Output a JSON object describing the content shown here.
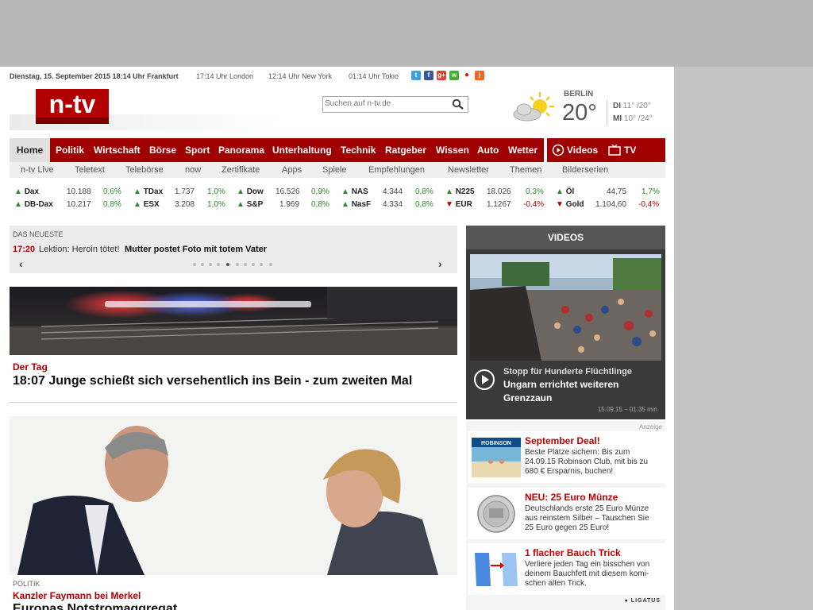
{
  "topbar": {
    "date": "Dienstag, 15. September 2015 18:14 Uhr Frankfurt",
    "london": "17:14 Uhr London",
    "newyork": "12:14 Uhr New York",
    "tokio": "01:14 Uhr Tokio",
    "social_icons": [
      "twitter-icon",
      "facebook-icon",
      "google-plus-icon",
      "whatsapp-icon",
      "pinterest-icon",
      "rss-icon"
    ]
  },
  "logo": {
    "text": "n-tv"
  },
  "search": {
    "placeholder": "Suchen auf n-tv.de"
  },
  "weather": {
    "city": "BERLIN",
    "temp": "20°",
    "forecast": [
      {
        "day": "DI",
        "range": "11° /20°"
      },
      {
        "day": "MI",
        "range": "10° /24°"
      }
    ]
  },
  "nav": {
    "items": [
      "Home",
      "Politik",
      "Wirtschaft",
      "Börse",
      "Sport",
      "Panorama",
      "Unterhaltung",
      "Technik",
      "Ratgeber",
      "Wissen",
      "Auto",
      "Wetter"
    ],
    "videos": "Videos",
    "tv": "TV",
    "active_color": "#9f0000"
  },
  "subnav": [
    "n-tv Live",
    "Teletext",
    "Telebörse",
    "now",
    "Zertifikate",
    "Apps",
    "Spiele",
    "Empfehlungen",
    "Newsletter",
    "Themen",
    "Bilderserien"
  ],
  "ticker": [
    {
      "name": "Dax",
      "value": "10.188",
      "change": "0,6%",
      "dir": "up"
    },
    {
      "name": "DB-Dax",
      "value": "10.217",
      "change": "0,8%",
      "dir": "up"
    },
    {
      "name": "TDax",
      "value": "1.737",
      "change": "1,0%",
      "dir": "up"
    },
    {
      "name": "ESX",
      "value": "3.208",
      "change": "1,0%",
      "dir": "up"
    },
    {
      "name": "Dow",
      "value": "16.526",
      "change": "0,9%",
      "dir": "up"
    },
    {
      "name": "S&P",
      "value": "1.969",
      "change": "0,8%",
      "dir": "up"
    },
    {
      "name": "NAS",
      "value": "4.344",
      "change": "0,8%",
      "dir": "up"
    },
    {
      "name": "NasF",
      "value": "4.334",
      "change": "0,8%",
      "dir": "up"
    },
    {
      "name": "N225",
      "value": "18.026",
      "change": "0,3%",
      "dir": "up"
    },
    {
      "name": "EUR",
      "value": "1,1267",
      "change": "-0,4%",
      "dir": "down"
    },
    {
      "name": "Öl",
      "value": "44,75",
      "change": "1,7%",
      "dir": "up"
    },
    {
      "name": "Gold",
      "value": "1.104,60",
      "change": "-0,4%",
      "dir": "down"
    }
  ],
  "newest": {
    "label": "DAS NEUESTE",
    "time": "17:20",
    "kicker": "Lektion: Heroin tötet!",
    "headline": "Mutter postet Foto mit totem Vater",
    "active_slide": 5,
    "slide_count": 10
  },
  "story1": {
    "category": "Der Tag",
    "title": "18:07 Junge schießt sich versehentlich ins Bein - zum zweiten Mal"
  },
  "story2": {
    "section": "POLITIK",
    "kicker": "Kanzler Faymann bei Merkel",
    "title": "Europas Notstromaggregat"
  },
  "videos": {
    "header": "VIDEOS",
    "kicker": "Stopp für Hunderte Flüchtlinge",
    "title": "Ungarn errichtet weiteren Grenzzaun",
    "meta": "15.09.15 – 01:35 min"
  },
  "ads": {
    "label": "Anzeige",
    "items": [
      {
        "title": "September Deal!",
        "text": "Beste Plätze sichern: Bis zum 24.09.15 Robinson Club, mit bis zu 680 € Ersparnis, buchen!",
        "image_text": "ROBINSON"
      },
      {
        "title": "NEU: 25 Euro Münze",
        "text": "Deutschlands erste 25 Euro Münze aus reinstem Silber – Tauschen Sie 25 Euro gegen 25 Euro!"
      },
      {
        "title": "1 flacher Bauch Trick",
        "text": "Verliere jeden Tag ein bisschen von deinem Bauchfett mit diesem komi-schen alten Trick."
      }
    ],
    "provider": "LIGATUS"
  }
}
